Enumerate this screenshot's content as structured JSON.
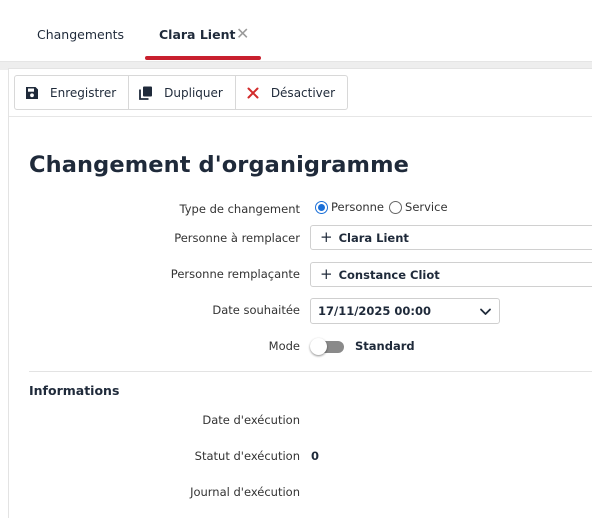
{
  "tabs": [
    {
      "label": "Changements",
      "active": false
    },
    {
      "label": "Clara Lient",
      "active": true,
      "closable": true
    }
  ],
  "tab_close_icon": "close-icon",
  "accent_color": "#c8202e",
  "toolbar": {
    "save_label": "Enregistrer",
    "duplicate_label": "Dupliquer",
    "deactivate_label": "Désactiver"
  },
  "page": {
    "title": "Changement d'organigramme"
  },
  "form": {
    "type": {
      "label": "Type de changement",
      "options": [
        "Personne",
        "Service"
      ],
      "selected": "Personne"
    },
    "person_to_replace": {
      "label": "Personne à remplacer",
      "value": "Clara Lient"
    },
    "replacement_person": {
      "label": "Personne remplaçante",
      "value": "Constance Cliot"
    },
    "desired_date": {
      "label": "Date souhaitée",
      "value": "17/11/2025 00:00"
    },
    "mode": {
      "label": "Mode",
      "value": "Standard",
      "enabled": false
    }
  },
  "info": {
    "title": "Informations",
    "execution_date": {
      "label": "Date d'exécution",
      "value": ""
    },
    "execution_status": {
      "label": "Statut d'exécution",
      "value": "0"
    },
    "execution_log": {
      "label": "Journal d'exécution",
      "value": ""
    }
  }
}
